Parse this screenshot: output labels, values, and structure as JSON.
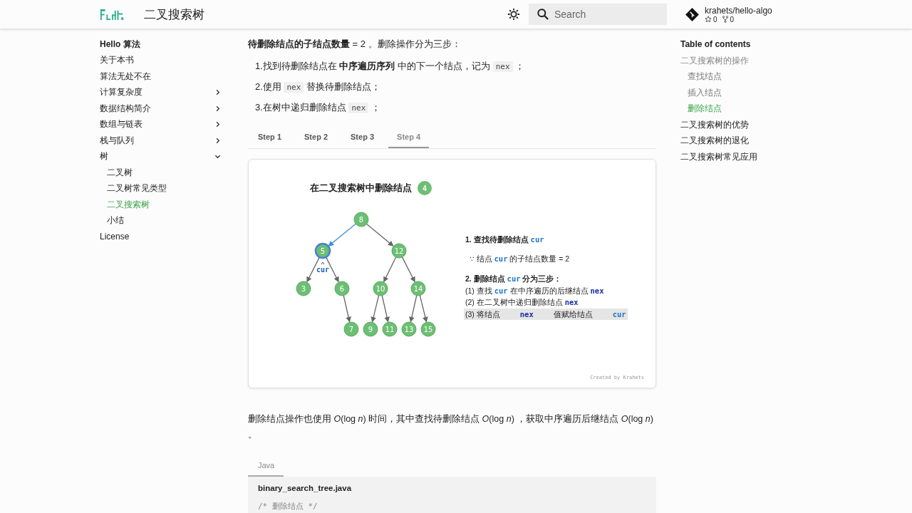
{
  "header": {
    "title": "二叉搜索树",
    "search": {
      "placeholder": "Search"
    },
    "repo": {
      "name": "krahets/hello-algo",
      "stars": "0",
      "forks": "0"
    }
  },
  "nav": {
    "title": "Hello 算法",
    "items": [
      {
        "label": "关于本书",
        "selected": false
      },
      {
        "label": "算法无处不在",
        "selected": false
      },
      {
        "label": "计算复杂度",
        "expanded": false,
        "selected": false
      },
      {
        "label": "数据结构简介",
        "expanded": false,
        "selected": false
      },
      {
        "label": "数组与链表",
        "expanded": false,
        "selected": false
      },
      {
        "label": "栈与队列",
        "expanded": false,
        "selected": false
      },
      {
        "label": "树",
        "expanded": true,
        "selected": false,
        "children": [
          {
            "label": "二叉树",
            "selected": false
          },
          {
            "label": "二叉树常见类型",
            "selected": false
          },
          {
            "label": "二叉搜索树",
            "selected": true
          },
          {
            "label": "小结",
            "selected": false
          }
        ]
      },
      {
        "label": "License",
        "selected": false
      }
    ]
  },
  "content": {
    "intro": "**待删除结点的子结点数量** = 2 。删除操作分为三步：",
    "steps": [
      {
        "number": "1.",
        "parts": [
          {
            "kind": "text",
            "text": "找到待删除结点在 "
          },
          {
            "kind": "bold",
            "text": "中序遍历序列"
          },
          {
            "kind": "text",
            "text": " 中的下一个结点，记为 "
          },
          {
            "kind": "code",
            "text": "nex"
          },
          {
            "kind": "text",
            "text": " ；"
          }
        ]
      },
      {
        "number": "2.",
        "parts": [
          {
            "kind": "text",
            "text": "使用 "
          },
          {
            "kind": "code",
            "text": "nex"
          },
          {
            "kind": "text",
            "text": " 替换待删除结点；"
          }
        ]
      },
      {
        "number": "3.",
        "parts": [
          {
            "kind": "text",
            "text": "在树中递归删除结点 "
          },
          {
            "kind": "code",
            "text": "nex"
          },
          {
            "kind": "text",
            "text": " ；"
          }
        ]
      }
    ],
    "tabs": [
      {
        "label": "Step 1",
        "selected": false
      },
      {
        "label": "Step 2",
        "selected": false
      },
      {
        "label": "Step 3",
        "selected": false
      },
      {
        "label": "Step 4",
        "selected": true
      }
    ],
    "figure": {
      "title": "在二叉搜索树中删除结点",
      "badge": "4",
      "tree": {
        "value": "8",
        "selected": false,
        "left": {
          "value": "5",
          "selected": true,
          "pointer": "cur",
          "left": {
            "value": "3",
            "selected": false
          },
          "right": {
            "value": "6",
            "selected": false,
            "right": {
              "value": "7",
              "selected": false
            }
          }
        },
        "right": {
          "value": "12",
          "selected": false,
          "left": {
            "value": "10",
            "selected": false,
            "left": {
              "value": "9",
              "selected": false
            },
            "right": {
              "value": "11",
              "selected": false
            }
          },
          "right": {
            "value": "14",
            "selected": false,
            "left": {
              "value": "13",
              "selected": false
            },
            "right": {
              "value": "15",
              "selected": false
            }
          }
        }
      },
      "notes": [
        {
          "kind": "heading",
          "highlighted": false,
          "parts": [
            {
              "kind": "text",
              "text": "1. 查找待删除结点 "
            },
            {
              "kind": "var",
              "text": "cur"
            }
          ]
        },
        {
          "kind": "line",
          "highlighted": false,
          "parts": [
            {
              "kind": "text",
              "text": "∵ 结点 "
            },
            {
              "kind": "var",
              "text": "cur"
            },
            {
              "kind": "text",
              "text": " 的子结点数量 = 2"
            }
          ]
        },
        {
          "kind": "heading",
          "highlighted": false,
          "parts": [
            {
              "kind": "text",
              "text": "2. 删除结点 "
            },
            {
              "kind": "var",
              "text": "cur"
            },
            {
              "kind": "text",
              "text": " 分为三步："
            }
          ]
        },
        {
          "kind": "line",
          "highlighted": false,
          "parts": [
            {
              "kind": "text",
              "text": "(1) 查找 "
            },
            {
              "kind": "var",
              "text": "cur"
            },
            {
              "kind": "text",
              "text": " 在中序遍历的后继结点 "
            },
            {
              "kind": "var2",
              "text": "nex"
            }
          ]
        },
        {
          "kind": "line",
          "highlighted": false,
          "parts": [
            {
              "kind": "text",
              "text": "(2) 在二叉树中递归删除结点 "
            },
            {
              "kind": "var2",
              "text": "nex"
            }
          ]
        },
        {
          "kind": "line",
          "highlighted": true,
          "parts": [
            {
              "kind": "text",
              "text": "(3) 将结点 "
            },
            {
              "kind": "var2",
              "text": "nex"
            },
            {
              "kind": "text",
              "text": " 值赋给结点 "
            },
            {
              "kind": "var",
              "text": "cur"
            }
          ]
        }
      ],
      "credit": "Created by Krahets"
    },
    "paragraph": "删除结点操作也使用 *O*(log *n*) 时间，其中查找待删除结点 *O*(log *n*) ，获取中序遍历后继结点 *O*(log *n*) 。",
    "code_tabs": [
      {
        "label": "Java",
        "selected": true
      }
    ],
    "code": {
      "filename": "binary_search_tree.java",
      "lines": [
        "/* 删除结点 */"
      ]
    }
  },
  "toc": {
    "title": "Table of contents",
    "items": [
      {
        "label": "二叉搜索树的操作",
        "selected": false,
        "children": [
          {
            "label": "查找结点",
            "selected": false
          },
          {
            "label": "插入结点",
            "selected": false
          },
          {
            "label": "删除结点",
            "selected": true
          }
        ]
      },
      {
        "label": "二叉搜索树的优势",
        "selected": false
      },
      {
        "label": "二叉搜索树的退化",
        "selected": false
      },
      {
        "label": "二叉搜索树常见应用",
        "selected": false
      }
    ]
  }
}
